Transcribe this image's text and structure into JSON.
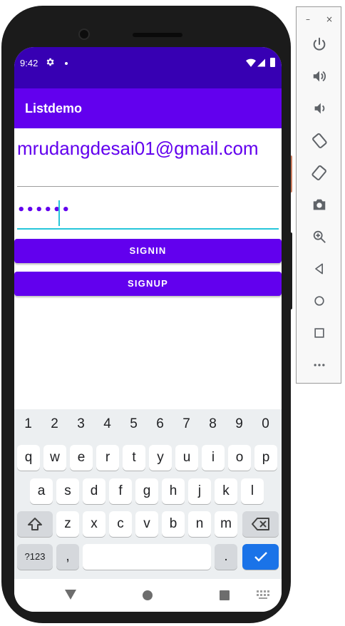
{
  "status_bar": {
    "time": "9:42",
    "icons": [
      "gear-icon",
      "notification-dot-icon",
      "wifi-icon",
      "signal-icon",
      "battery-icon"
    ]
  },
  "app_bar": {
    "title": "Listdemo",
    "color": "#6200ee"
  },
  "form": {
    "email_value": "mrudangdesai01@gmail.com",
    "password_value": "••••••",
    "signin_label": "SIGNIN",
    "signup_label": "SIGNUP"
  },
  "keyboard": {
    "numbers": [
      "1",
      "2",
      "3",
      "4",
      "5",
      "6",
      "7",
      "8",
      "9",
      "0"
    ],
    "row1": [
      "q",
      "w",
      "e",
      "r",
      "t",
      "y",
      "u",
      "i",
      "o",
      "p"
    ],
    "row2": [
      "a",
      "s",
      "d",
      "f",
      "g",
      "h",
      "j",
      "k",
      "l"
    ],
    "row3": [
      "z",
      "x",
      "c",
      "v",
      "b",
      "n",
      "m"
    ],
    "symbols_label": "?123",
    "comma_label": ",",
    "period_label": ".",
    "icons": [
      "shift-icon",
      "backspace-icon",
      "enter-check-icon"
    ]
  },
  "nav_bar": {
    "icons": [
      "back-icon",
      "home-icon",
      "recents-icon",
      "keyboard-switch-icon"
    ]
  },
  "emulator": {
    "window_controls": {
      "minimize": "–",
      "close": "×"
    },
    "tools": [
      "power-icon",
      "volume-up-icon",
      "volume-down-icon",
      "rotate-left-icon",
      "rotate-right-icon",
      "camera-icon",
      "zoom-icon",
      "back-icon",
      "home-icon",
      "overview-icon",
      "more-icon"
    ]
  },
  "colors": {
    "primary": "#6200ee",
    "primary_dark": "#3700b3",
    "accent": "#26c6da",
    "enter_key": "#1a73e8"
  }
}
